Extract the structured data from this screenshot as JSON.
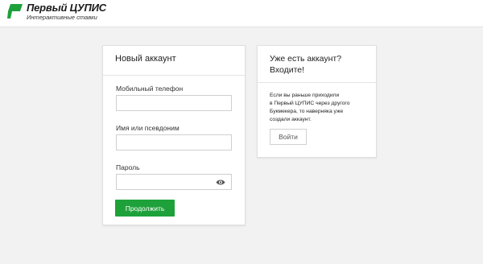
{
  "header": {
    "logo_title": "Первый ЦУПИС",
    "logo_subtitle": "Интерактивные ставки",
    "logo_icon": "green-flag-logo"
  },
  "register": {
    "title": "Новый аккаунт",
    "phone_label": "Мобильный телефон",
    "phone_value": "",
    "nickname_label": "Имя или псевдоним",
    "nickname_value": "",
    "password_label": "Пароль",
    "password_value": "",
    "password_toggle_icon": "eye-icon",
    "submit_label": "Продолжить"
  },
  "login": {
    "title_line1": "Уже есть аккаунт?",
    "title_line2": "Входите!",
    "info_lines": [
      "Если вы раньше приходили",
      "в Первый ЦУПИС через другого",
      "Букмекера, то наверняка уже",
      "создали аккаунт."
    ],
    "button_label": "Войти"
  },
  "colors": {
    "accent_green": "#1ea13a",
    "background": "#f2f2f2",
    "card": "#ffffff"
  }
}
